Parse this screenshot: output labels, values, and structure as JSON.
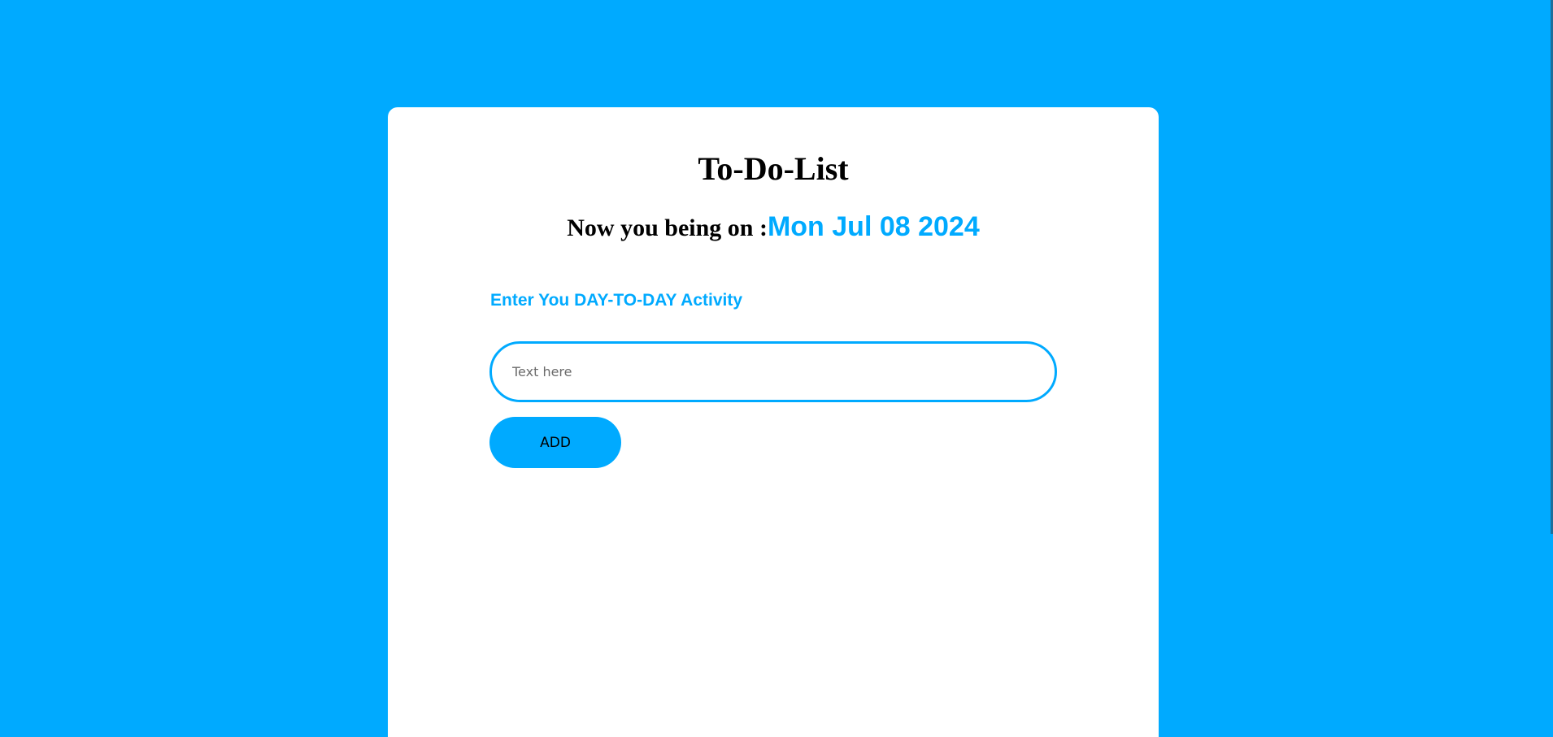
{
  "app": {
    "title": "To-Do-List"
  },
  "date_line": {
    "label": "Now you being on :",
    "value": "Mon Jul 08 2024"
  },
  "activity": {
    "label": "Enter You DAY-TO-DAY Activity"
  },
  "input": {
    "value": "",
    "placeholder": "Text here"
  },
  "add_button": {
    "label": "ADD"
  },
  "colors": {
    "background": "#00aaff",
    "accent": "#00aaff",
    "card": "#ffffff",
    "text": "#000000"
  }
}
